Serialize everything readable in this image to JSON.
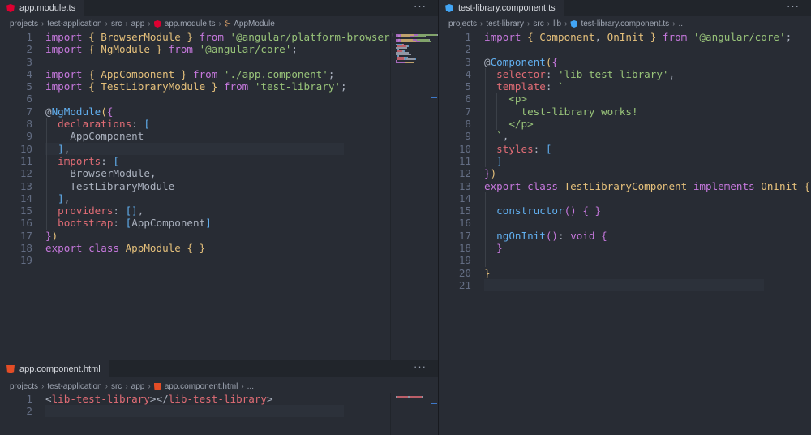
{
  "panes": {
    "left_top": {
      "tab_label": "app.module.ts",
      "more_label": "···",
      "breadcrumb": [
        "projects",
        "test-application",
        "src",
        "app",
        "app.module.ts",
        "AppModule"
      ],
      "line_numbers": [
        "1",
        "2",
        "3",
        "4",
        "5",
        "6",
        "7",
        "8",
        "9",
        "10",
        "11",
        "12",
        "13",
        "14",
        "15",
        "16",
        "17",
        "18",
        "19"
      ]
    },
    "left_bottom": {
      "tab_label": "app.component.html",
      "more_label": "···",
      "breadcrumb": [
        "projects",
        "test-application",
        "src",
        "app",
        "app.component.html",
        "..."
      ],
      "line_numbers": [
        "1",
        "2"
      ]
    },
    "right": {
      "tab_label": "test-library.component.ts",
      "more_label": "···",
      "breadcrumb": [
        "projects",
        "test-library",
        "src",
        "lib",
        "test-library.component.ts",
        "..."
      ],
      "line_numbers": [
        "1",
        "2",
        "3",
        "4",
        "5",
        "6",
        "7",
        "8",
        "9",
        "10",
        "11",
        "12",
        "13",
        "14",
        "15",
        "16",
        "17",
        "18",
        "19",
        "20",
        "21"
      ]
    }
  },
  "code": {
    "app_module": [
      [
        [
          "kw",
          "import "
        ],
        [
          "br1",
          "{ "
        ],
        [
          "cls",
          "BrowserModule"
        ],
        [
          "br1",
          " }"
        ],
        [
          "kw",
          " from "
        ],
        [
          "str",
          "'@angular/platform-browser'"
        ],
        [
          "pun",
          ";"
        ]
      ],
      [
        [
          "kw",
          "import "
        ],
        [
          "br1",
          "{ "
        ],
        [
          "cls",
          "NgModule"
        ],
        [
          "br1",
          " }"
        ],
        [
          "kw",
          " from "
        ],
        [
          "str",
          "'@angular/core'"
        ],
        [
          "pun",
          ";"
        ]
      ],
      [],
      [
        [
          "kw",
          "import "
        ],
        [
          "br1",
          "{ "
        ],
        [
          "cls",
          "AppComponent"
        ],
        [
          "br1",
          " }"
        ],
        [
          "kw",
          " from "
        ],
        [
          "str",
          "'./app.component'"
        ],
        [
          "pun",
          ";"
        ]
      ],
      [
        [
          "kw",
          "import "
        ],
        [
          "br1",
          "{ "
        ],
        [
          "cls",
          "TestLibraryModule"
        ],
        [
          "br1",
          " }"
        ],
        [
          "kw",
          " from "
        ],
        [
          "str",
          "'test-library'"
        ],
        [
          "pun",
          ";"
        ]
      ],
      [],
      [
        [
          "pun",
          "@"
        ],
        [
          "dec",
          "NgModule"
        ],
        [
          "br1",
          "("
        ],
        [
          "br2",
          "{"
        ]
      ],
      [
        [
          "pun",
          "  "
        ],
        [
          "prop",
          "declarations"
        ],
        [
          "pun",
          ": "
        ],
        [
          "fn",
          "["
        ]
      ],
      [
        [
          "pun",
          "    AppComponent"
        ]
      ],
      [
        [
          "pun",
          "  "
        ],
        [
          "fn",
          "]"
        ],
        [
          "pun",
          ","
        ]
      ],
      [
        [
          "pun",
          "  "
        ],
        [
          "prop",
          "imports"
        ],
        [
          "pun",
          ": "
        ],
        [
          "fn",
          "["
        ]
      ],
      [
        [
          "pun",
          "    BrowserModule,"
        ]
      ],
      [
        [
          "pun",
          "    TestLibraryModule"
        ]
      ],
      [
        [
          "pun",
          "  "
        ],
        [
          "fn",
          "]"
        ],
        [
          "pun",
          ","
        ]
      ],
      [
        [
          "pun",
          "  "
        ],
        [
          "prop",
          "providers"
        ],
        [
          "pun",
          ": "
        ],
        [
          "fn",
          "[]"
        ],
        [
          "pun",
          ","
        ]
      ],
      [
        [
          "pun",
          "  "
        ],
        [
          "prop",
          "bootstrap"
        ],
        [
          "pun",
          ": "
        ],
        [
          "fn",
          "["
        ],
        [
          "pun",
          "AppComponent"
        ],
        [
          "fn",
          "]"
        ]
      ],
      [
        [
          "br2",
          "}"
        ],
        [
          "br1",
          ")"
        ]
      ],
      [
        [
          "kw",
          "export "
        ],
        [
          "kw",
          "class "
        ],
        [
          "cls",
          "AppModule"
        ],
        [
          "br1",
          " { }"
        ]
      ],
      []
    ],
    "app_component_html": [
      [
        [
          "pun",
          "<"
        ],
        [
          "tag",
          "lib-test-library"
        ],
        [
          "pun",
          "></"
        ],
        [
          "tag",
          "lib-test-library"
        ],
        [
          "pun",
          ">"
        ]
      ],
      []
    ],
    "library_component": [
      [
        [
          "kw",
          "import "
        ],
        [
          "br1",
          "{ "
        ],
        [
          "cls",
          "Component"
        ],
        [
          "pun",
          ", "
        ],
        [
          "cls",
          "OnInit"
        ],
        [
          "br1",
          " }"
        ],
        [
          "kw",
          " from "
        ],
        [
          "str",
          "'@angular/core'"
        ],
        [
          "pun",
          ";"
        ]
      ],
      [],
      [
        [
          "pun",
          "@"
        ],
        [
          "dec",
          "Component"
        ],
        [
          "br1",
          "("
        ],
        [
          "br2",
          "{"
        ]
      ],
      [
        [
          "pun",
          "  "
        ],
        [
          "prop",
          "selector"
        ],
        [
          "pun",
          ": "
        ],
        [
          "str",
          "'lib-test-library'"
        ],
        [
          "pun",
          ","
        ]
      ],
      [
        [
          "pun",
          "  "
        ],
        [
          "prop",
          "template"
        ],
        [
          "pun",
          ": "
        ],
        [
          "str",
          "`"
        ]
      ],
      [
        [
          "str",
          "    <p>"
        ]
      ],
      [
        [
          "str",
          "      test-library works!"
        ]
      ],
      [
        [
          "str",
          "    </p>"
        ]
      ],
      [
        [
          "str",
          "  `"
        ],
        [
          "pun",
          ","
        ]
      ],
      [
        [
          "pun",
          "  "
        ],
        [
          "prop",
          "styles"
        ],
        [
          "pun",
          ": "
        ],
        [
          "fn",
          "["
        ]
      ],
      [
        [
          "pun",
          "  "
        ],
        [
          "fn",
          "]"
        ]
      ],
      [
        [
          "br2",
          "}"
        ],
        [
          "br1",
          ")"
        ]
      ],
      [
        [
          "kw",
          "export "
        ],
        [
          "kw",
          "class "
        ],
        [
          "cls",
          "TestLibraryComponent"
        ],
        [
          "kw",
          " implements "
        ],
        [
          "cls",
          "OnInit"
        ],
        [
          "br1",
          " {"
        ]
      ],
      [],
      [
        [
          "pun",
          "  "
        ],
        [
          "fn",
          "constructor"
        ],
        [
          "br2",
          "()"
        ],
        [
          "br2",
          " { }"
        ]
      ],
      [],
      [
        [
          "pun",
          "  "
        ],
        [
          "fn",
          "ngOnInit"
        ],
        [
          "br2",
          "()"
        ],
        [
          "pun",
          ": "
        ],
        [
          "kw",
          "void"
        ],
        [
          "br2",
          " {"
        ]
      ],
      [
        [
          "br2",
          "  }"
        ]
      ],
      [],
      [
        [
          "br1",
          "}"
        ]
      ],
      []
    ]
  },
  "colors": {
    "background": "#282c34",
    "tabbar": "#21252b",
    "keyword": "#c678dd",
    "string": "#98c379",
    "class": "#e5c07b",
    "property": "#e06c75",
    "function": "#61afef"
  }
}
